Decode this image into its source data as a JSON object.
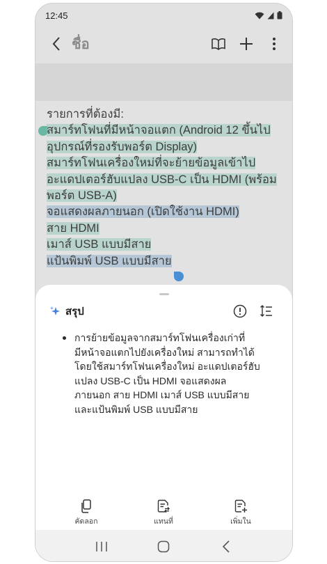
{
  "status": {
    "time": "12:45"
  },
  "appbar": {
    "title": "ชื่อ"
  },
  "note": {
    "lines": [
      "รายการที่ต้องมี:",
      "สมาร์ทโฟนที่มีหน้าจอแตก (Android 12 ขึ้นไป",
      "อุปกรณ์ที่รองรับพอร์ต Display)",
      "สมาร์ทโฟนเครื่องใหม่ที่จะย้ายข้อมูลเข้าไป",
      "อะแดปเตอร์ฮับแปลง USB-C เป็น HDMI (พร้อม",
      "พอร์ต USB-A)",
      "จอแสดงผลภายนอก (เปิดใช้งาน HDMI)",
      "สาย HDMI",
      "เมาส์ USB แบบมีสาย",
      "แป้นพิมพ์ USB แบบมีสาย"
    ]
  },
  "sheet": {
    "title": "สรุป",
    "summary_lines": [
      "การย้ายข้อมูลจากสมาร์ทโฟนเครื่องเก่าที่",
      "มีหน้าจอแตกไปยังเครื่องใหม่ สามารถทำได้",
      "โดยใช้สมาร์ทโฟนเครื่องใหม่ อะแดปเตอร์ฮับ",
      "แปลง USB-C เป็น HDMI จอแสดงผล",
      "ภายนอก สาย HDMI เมาส์ USB แบบมีสาย",
      "และแป้นพิมพ์ USB แบบมีสาย"
    ],
    "actions": {
      "copy": "คัดลอก",
      "replace": "แทนที่",
      "add": "เพิ่มใน"
    }
  },
  "colors": {
    "selection_green": "#96c8b9",
    "selection_blue": "#a5bed2",
    "accent": "#4a8fd6"
  }
}
